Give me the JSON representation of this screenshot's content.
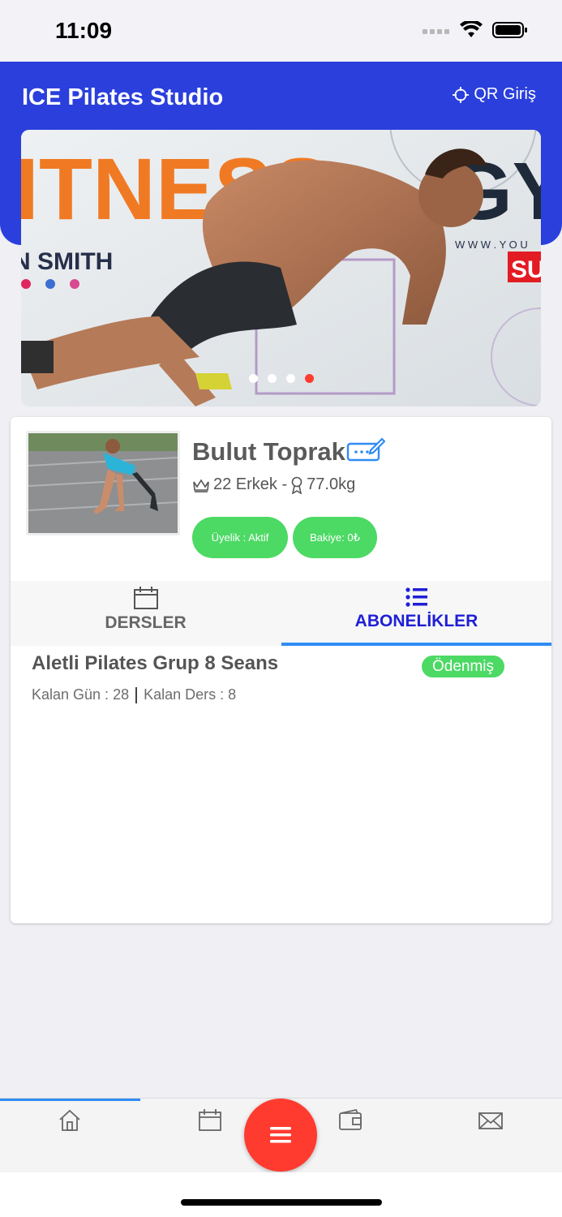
{
  "status_bar": {
    "time": "11:09"
  },
  "header": {
    "title": "ICE Pilates Studio",
    "qr_label": "QR Giriş"
  },
  "banner": {
    "text_top": "ITNESS",
    "text_right": "GY",
    "text_name": "N SMITH",
    "text_url": "W W W . Y O U",
    "text_badge": "SU",
    "carousel_total": 4,
    "carousel_active": 4
  },
  "profile": {
    "name": "Bulut Toprak",
    "age_gender": "22 Erkek -",
    "weight": "77.0kg",
    "membership_label": "Üyelik : Aktif",
    "balance_label": "Bakiye: 0₺"
  },
  "tabs": [
    {
      "label": "DERSLER",
      "active": false
    },
    {
      "label": "ABONELİKLER",
      "active": true
    }
  ],
  "subscription": {
    "title": "Aletli Pilates Grup 8 Seans",
    "status": "Ödenmiş",
    "remaining_days": "Kalan Gün : 28",
    "remaining_lessons": "Kalan Ders : 8"
  },
  "bottom_nav": [
    {
      "icon": "home-icon",
      "active": true
    },
    {
      "icon": "calendar-icon",
      "active": false
    },
    {
      "icon": "menu-icon",
      "active": false
    },
    {
      "icon": "wallet-icon",
      "active": false
    },
    {
      "icon": "mail-icon",
      "active": false
    }
  ],
  "colors": {
    "brand_blue": "#2a3fdc",
    "tab_active": "#1f1fd6",
    "accent_green": "#4cd964",
    "fab_red": "#ff3b30",
    "underline_blue": "#2f8cf5"
  }
}
